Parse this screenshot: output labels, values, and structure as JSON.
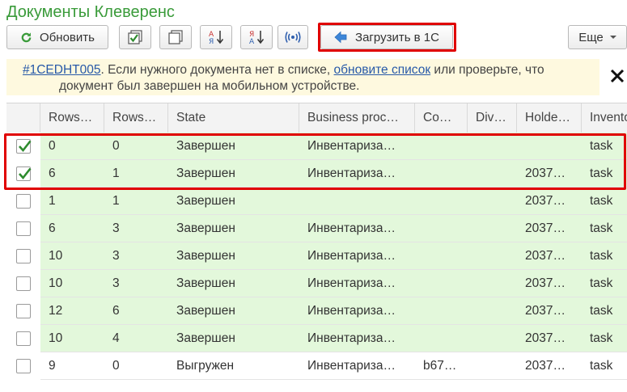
{
  "window": {
    "title": "Документы Клеверенс"
  },
  "toolbar": {
    "refresh_label": "Обновить",
    "load_label": "Загрузить в 1С",
    "more_label": "Еще"
  },
  "banner": {
    "link_code": "#1CEDHT005",
    "text_before": ". Если нужного документа нет в списке, ",
    "link_refresh": "обновите список",
    "text_after": " или проверьте, что",
    "line2": "документ был завершен на мобильном устройстве."
  },
  "table": {
    "columns": [
      "Rows…",
      "Rows…",
      "State",
      "Business proc…",
      "Co…",
      "Div…",
      "Holde…",
      "Invento"
    ],
    "rows": [
      {
        "checked": true,
        "cells": [
          "0",
          "0",
          "Завершен",
          "Инвентариза…",
          "",
          "",
          "",
          "task"
        ],
        "style": "green"
      },
      {
        "checked": true,
        "cells": [
          "6",
          "1",
          "Завершен",
          "Инвентариза…",
          "",
          "",
          "2037…",
          "task"
        ],
        "style": "green"
      },
      {
        "checked": false,
        "cells": [
          "1",
          "1",
          "Завершен",
          "",
          "",
          "",
          "2037…",
          "task"
        ],
        "style": "green"
      },
      {
        "checked": false,
        "cells": [
          "6",
          "3",
          "Завершен",
          "Инвентариза…",
          "",
          "",
          "2037…",
          "task"
        ],
        "style": "green"
      },
      {
        "checked": false,
        "cells": [
          "10",
          "3",
          "Завершен",
          "Инвентариза…",
          "",
          "",
          "2037…",
          "task"
        ],
        "style": "green"
      },
      {
        "checked": false,
        "cells": [
          "10",
          "3",
          "Завершен",
          "Инвентариза…",
          "",
          "",
          "2037…",
          "task"
        ],
        "style": "green"
      },
      {
        "checked": false,
        "cells": [
          "12",
          "6",
          "Завершен",
          "Инвентариза…",
          "",
          "",
          "2037…",
          "task"
        ],
        "style": "green"
      },
      {
        "checked": false,
        "cells": [
          "10",
          "4",
          "Завершен",
          "Инвентариза…",
          "",
          "",
          "2037…",
          "task"
        ],
        "style": "green"
      },
      {
        "checked": false,
        "cells": [
          "9",
          "0",
          "Выгружен",
          "Инвентариза…",
          "b67…",
          "",
          "2037…",
          "task"
        ],
        "style": "white"
      }
    ]
  },
  "colors": {
    "title_green": "#3a9b3a",
    "row_green": "#e3f8db",
    "banner_bg": "#fef9df",
    "highlight_red": "#e00000",
    "link_blue": "#2759a8"
  }
}
